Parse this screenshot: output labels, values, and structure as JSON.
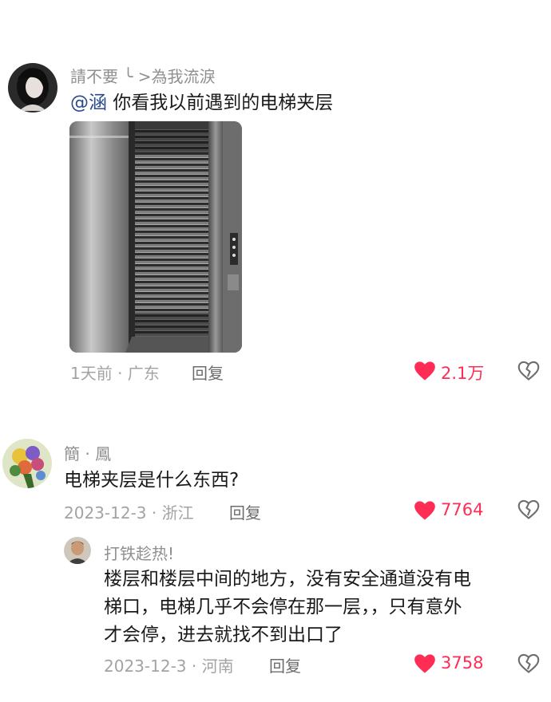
{
  "comment1": {
    "username": "請不要 ╰ >為我流淚",
    "mention": "@涵",
    "text": " 你看我以前遇到的电梯夹层",
    "time_location": "1天前 · 广东",
    "reply_label": "回复",
    "likes": "2.1万",
    "avatar_icon": "avatar-girl-icon"
  },
  "comment2": {
    "username": "簡 · 鳳",
    "text": "电梯夹层是什么东西?",
    "time_location": "2023-12-3 · 浙江",
    "reply_label": "回复",
    "likes": "7764",
    "avatar_icon": "avatar-flowers-icon"
  },
  "reply1": {
    "username": "打铁趁热!",
    "text_line1": "楼层和楼层中间的地方，没有安全通道没有电",
    "text_line2": "梯口，电梯几乎不会停在那一层，，只有意外",
    "text_line3": "才会停，进去就找不到出口了",
    "time_location": "2023-12-3 · 河南",
    "reply_label": "回复",
    "likes": "3758",
    "avatar_icon": "avatar-man-icon"
  },
  "colors": {
    "like_red": "#ff2d55",
    "mention_blue": "#2a4a8c",
    "meta_gray": "#a3a3a3"
  }
}
